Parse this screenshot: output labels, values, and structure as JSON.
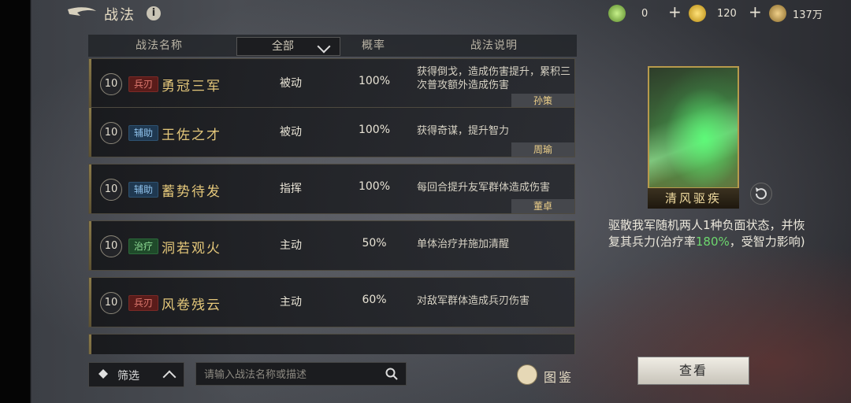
{
  "header": {
    "title": "战法",
    "resources": [
      {
        "icon": "jade-coin-icon",
        "value": "0"
      },
      {
        "icon": "gold-coin-icon",
        "value": "120"
      },
      {
        "icon": "copper-coin-icon",
        "value": "137万"
      }
    ]
  },
  "table": {
    "col_name": "战法名称",
    "filter_selected": "全部",
    "col_rate": "概率",
    "col_desc": "战法说明"
  },
  "tactics": [
    {
      "level": "10",
      "tag": "兵刃",
      "tag_color": "red",
      "name": "勇冠三军",
      "type": "被动",
      "rate": "100%",
      "desc": "获得倒戈，造成伤害提升，累积三次普攻额外造成伤害",
      "hero": "孙策"
    },
    {
      "level": "10",
      "tag": "辅助",
      "tag_color": "blue",
      "name": "王佐之才",
      "type": "被动",
      "rate": "100%",
      "desc": "获得奇谋，提升智力",
      "hero": "周瑜"
    },
    {
      "level": "10",
      "tag": "辅助",
      "tag_color": "blue",
      "name": "蓄势待发",
      "type": "指挥",
      "rate": "100%",
      "desc": "每回合提升友军群体造成伤害",
      "hero": "董卓"
    },
    {
      "level": "10",
      "tag": "治疗",
      "tag_color": "green",
      "name": "洞若观火",
      "type": "主动",
      "rate": "50%",
      "desc": "单体治疗并施加清醒",
      "hero": ""
    },
    {
      "level": "10",
      "tag": "兵刃",
      "tag_color": "red",
      "name": "风卷残云",
      "type": "主动",
      "rate": "60%",
      "desc": "对敌军群体造成兵刃伤害",
      "hero": ""
    }
  ],
  "bottom": {
    "filter_label": "筛选",
    "search_placeholder": "请输入战法名称或描述",
    "codex_label": "图鉴"
  },
  "detail": {
    "card_name": "清风驱疾",
    "effect_before": "驱散我军随机两人1种负面状态，并恢复其兵力(治疗率",
    "effect_highlight": "180%",
    "effect_after": "，受智力影响)",
    "view_label": "查看"
  }
}
